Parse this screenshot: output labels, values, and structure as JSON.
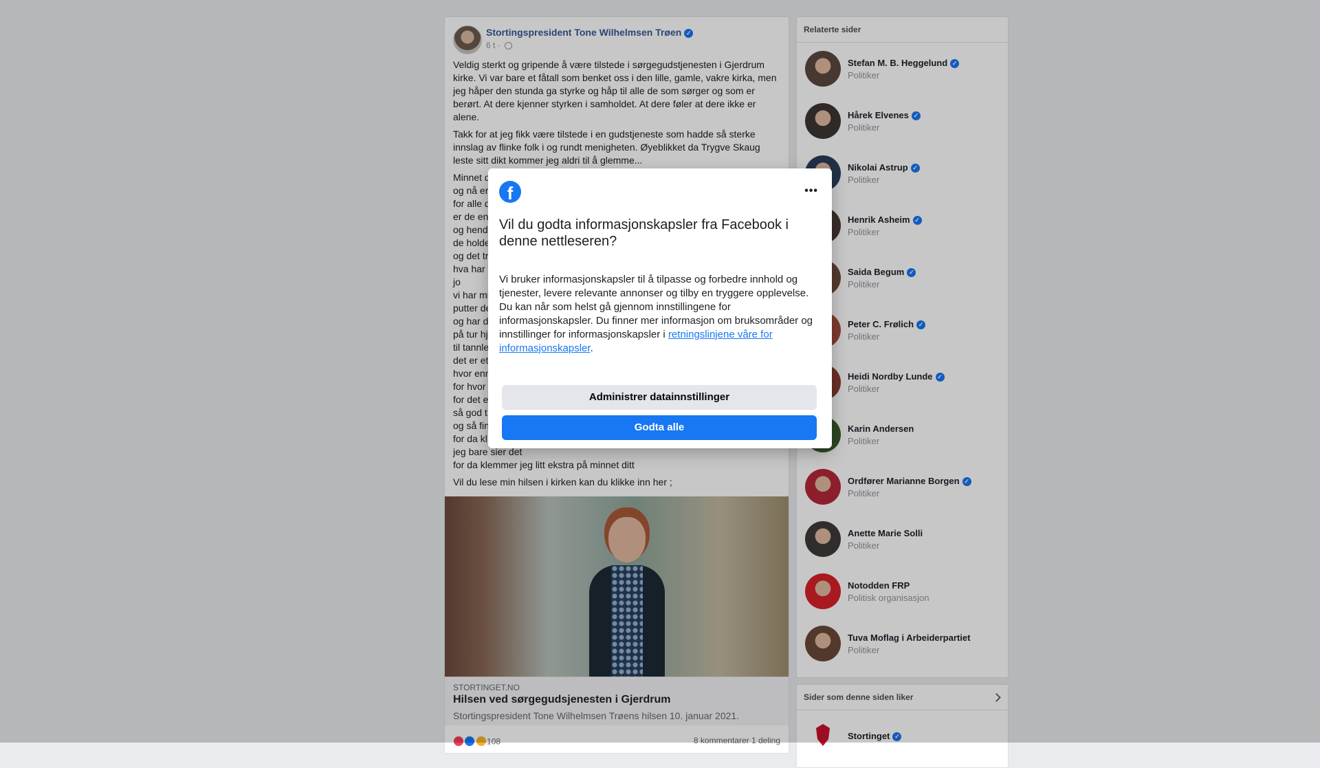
{
  "post": {
    "author": "Stortingspresident Tone Wilhelmsen Trøen",
    "time": "6 t ·",
    "paragraph1": "Veldig sterkt og gripende å være tilstede i sørgegudstjenesten i Gjerdrum kirke. Vi var bare et fåtall som benket oss i den lille, gamle, vakre kirka, men jeg håper den stunda ga styrke og håp til alle de som sørger og som er berørt. At dere kjenner styrken i samholdet. At dere føler at dere ikke er alene.",
    "paragraph2": "Takk for at jeg fikk være tilstede i en gudstjeneste som hadde så sterke innslag av flinke folk i og rundt menigheten. Øyeblikket da Trygve Skaug leste sitt dikt kommer jeg aldri til å glemme...",
    "poem": "Minnet d\nog nå er\nfor alle d\ner de en\nog hende\nde holde\nog det tr\nhva har v\njo\nvi har mi\nputter de\nog har d\npå tur hje\ntil tannle\ndet er et\nhvor enn\nfor hvor\nfor det e\nså god t\nog så fin\nfor da kl\njeg bare sier det\nfor da klemmer jeg litt ekstra på minnet ditt",
    "closing": "Vil du lese min hilsen i kirken kan du klikke inn her ;",
    "link": {
      "domain": "STORTINGET.NO",
      "title": "Hilsen ved sørgegudsjenesten i Gjerdrum",
      "description": "Stortingspresident Tone Wilhelmsen Trøens hilsen 10. januar 2021."
    },
    "reactions": {
      "count": "108",
      "comments_shares": "8 kommentarer 1 deling"
    }
  },
  "related": {
    "header": "Relaterte sider",
    "items": [
      {
        "name": "Stefan M. B. Heggelund",
        "category": "Politiker",
        "verified": true,
        "color": "#5b4a3f"
      },
      {
        "name": "Hårek Elvenes",
        "category": "Politiker",
        "verified": true,
        "color": "#3d3633"
      },
      {
        "name": "Nikolai Astrup",
        "category": "Politiker",
        "verified": true,
        "color": "#2c3e5a"
      },
      {
        "name": "Henrik Asheim",
        "category": "Politiker",
        "verified": true,
        "color": "#4a3a33"
      },
      {
        "name": "Saida Begum",
        "category": "Politiker",
        "verified": true,
        "color": "#6d4b3c"
      },
      {
        "name": "Peter C. Frølich",
        "category": "Politiker",
        "verified": true,
        "color": "#a44c3c"
      },
      {
        "name": "Heidi Nordby Lunde",
        "category": "Politiker",
        "verified": true,
        "color": "#8a3d2f"
      },
      {
        "name": "Karin Andersen",
        "category": "Politiker",
        "verified": false,
        "color": "#3a5a2f"
      },
      {
        "name": "Ordfører Marianne Borgen",
        "category": "Politiker",
        "verified": true,
        "color": "#b5283a"
      },
      {
        "name": "Anette Marie Solli",
        "category": "Politiker",
        "verified": false,
        "color": "#3f3a3a"
      },
      {
        "name": "Notodden FRP",
        "category": "Politisk organisasjon",
        "verified": false,
        "color": "#d8202a"
      },
      {
        "name": "Tuva Moflag i Arbeiderpartiet",
        "category": "Politiker",
        "verified": false,
        "color": "#6b4a38"
      }
    ]
  },
  "liked": {
    "header": "Sider som denne siden liker",
    "items": [
      {
        "name": "Stortinget",
        "verified": true
      }
    ]
  },
  "modal": {
    "logo": "f",
    "more": "•••",
    "title": "Vil du godta informasjonskapsler fra Facebook i denne nettleseren?",
    "text": "Vi bruker informasjonskapsler til å tilpasse og forbedre innhold og tjenester, levere relevante annonser og tilby en tryggere opplevelse. Du kan når som helst gå gjennom innstillingene for informasjonskapsler. Du finner mer informasjon om bruksområder og innstillinger for informasjonskapsler i ",
    "link_text": "retningslinjene våre for informasjonskapsler",
    "text_end": ".",
    "manage_button": "Administrer datainnstillinger",
    "accept_button": "Godta alle"
  },
  "colors": {
    "facebook_blue": "#1877f2",
    "author_link": "#385898"
  }
}
